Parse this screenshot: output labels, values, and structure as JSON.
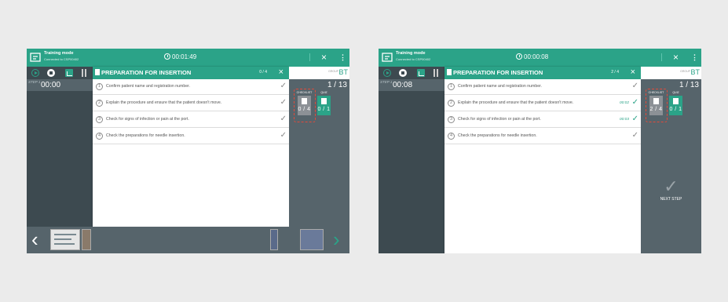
{
  "screens": [
    {
      "app": {
        "mode_title": "Training mode",
        "connection": "Connected to CSP00402"
      },
      "timer": "00:01:49",
      "step_label": "STEP 1",
      "step_time": "00:00",
      "group": {
        "label": "GROUP",
        "value": "BT"
      },
      "step_number": "1 / 13",
      "panel": {
        "title": "PREPARATION FOR INSERTION",
        "count": "0 / 4",
        "items": [
          {
            "num": "1",
            "text": "Confirm patient name and registration number.",
            "time": "",
            "done": false
          },
          {
            "num": "2",
            "text": "Explain the procedure and ensure that the patient doesn't move.",
            "time": "",
            "done": false
          },
          {
            "num": "3",
            "text": "Check for signs of infection or pain at the port.",
            "time": "",
            "done": false
          },
          {
            "num": "4",
            "text": "Check the preparations for needle insertion.",
            "time": "",
            "done": false
          }
        ]
      },
      "checklist": {
        "label": "CHECKLIST",
        "value": "0 / 4"
      },
      "quiz": {
        "label": "QUIZ",
        "value": "0 / 1"
      }
    },
    {
      "app": {
        "mode_title": "Training mode",
        "connection": "Connected to CSP00402"
      },
      "timer": "00:00:08",
      "step_label": "STEP 1",
      "step_time": "00:08",
      "group": {
        "label": "GROUP",
        "value": "BT"
      },
      "step_number": "1 / 13",
      "panel": {
        "title": "PREPARATION FOR INSERTION",
        "count": "2 / 4",
        "items": [
          {
            "num": "1",
            "text": "Confirm patient name and registration number.",
            "time": "",
            "done": false
          },
          {
            "num": "2",
            "text": "Explain the procedure and ensure that the patient doesn't move.",
            "time": "00:02",
            "done": true
          },
          {
            "num": "3",
            "text": "Check for signs of infection or pain at the port.",
            "time": "00:03",
            "done": true
          },
          {
            "num": "4",
            "text": "Check the preparations for needle insertion.",
            "time": "",
            "done": false
          }
        ]
      },
      "checklist": {
        "label": "CHECKLIST",
        "value": "2 / 4"
      },
      "quiz": {
        "label": "QUIZ",
        "value": "0 / 1"
      },
      "next_step_label": "NEXT STEP"
    }
  ],
  "icons": {
    "close": "×",
    "menu": "⋮",
    "check": "✓",
    "prev": "‹",
    "next": "›"
  },
  "colors": {
    "accent": "#2ba388",
    "highlight": "#e24a3a",
    "dark_panel": "#3d4a50"
  }
}
